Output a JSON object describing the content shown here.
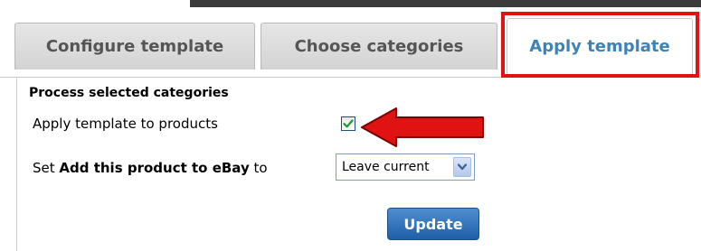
{
  "tabs": [
    {
      "label": "Configure template"
    },
    {
      "label": "Choose categories"
    },
    {
      "label": "Apply template",
      "active": true
    }
  ],
  "panel": {
    "section_title": "Process selected categories",
    "apply_label": "Apply template to products",
    "apply_checked": true,
    "set_prefix": "Set ",
    "set_bold": "Add this product to eBay",
    "set_suffix": " to",
    "select_value": "Leave current",
    "update_label": "Update"
  },
  "annotations": {
    "highlight_color": "#e01212",
    "arrow_color": "#e01212"
  },
  "icons": {
    "checkbox": "check-icon",
    "select_toggle": "chevron-down-icon",
    "annotation_arrow": "arrow-left-icon"
  }
}
